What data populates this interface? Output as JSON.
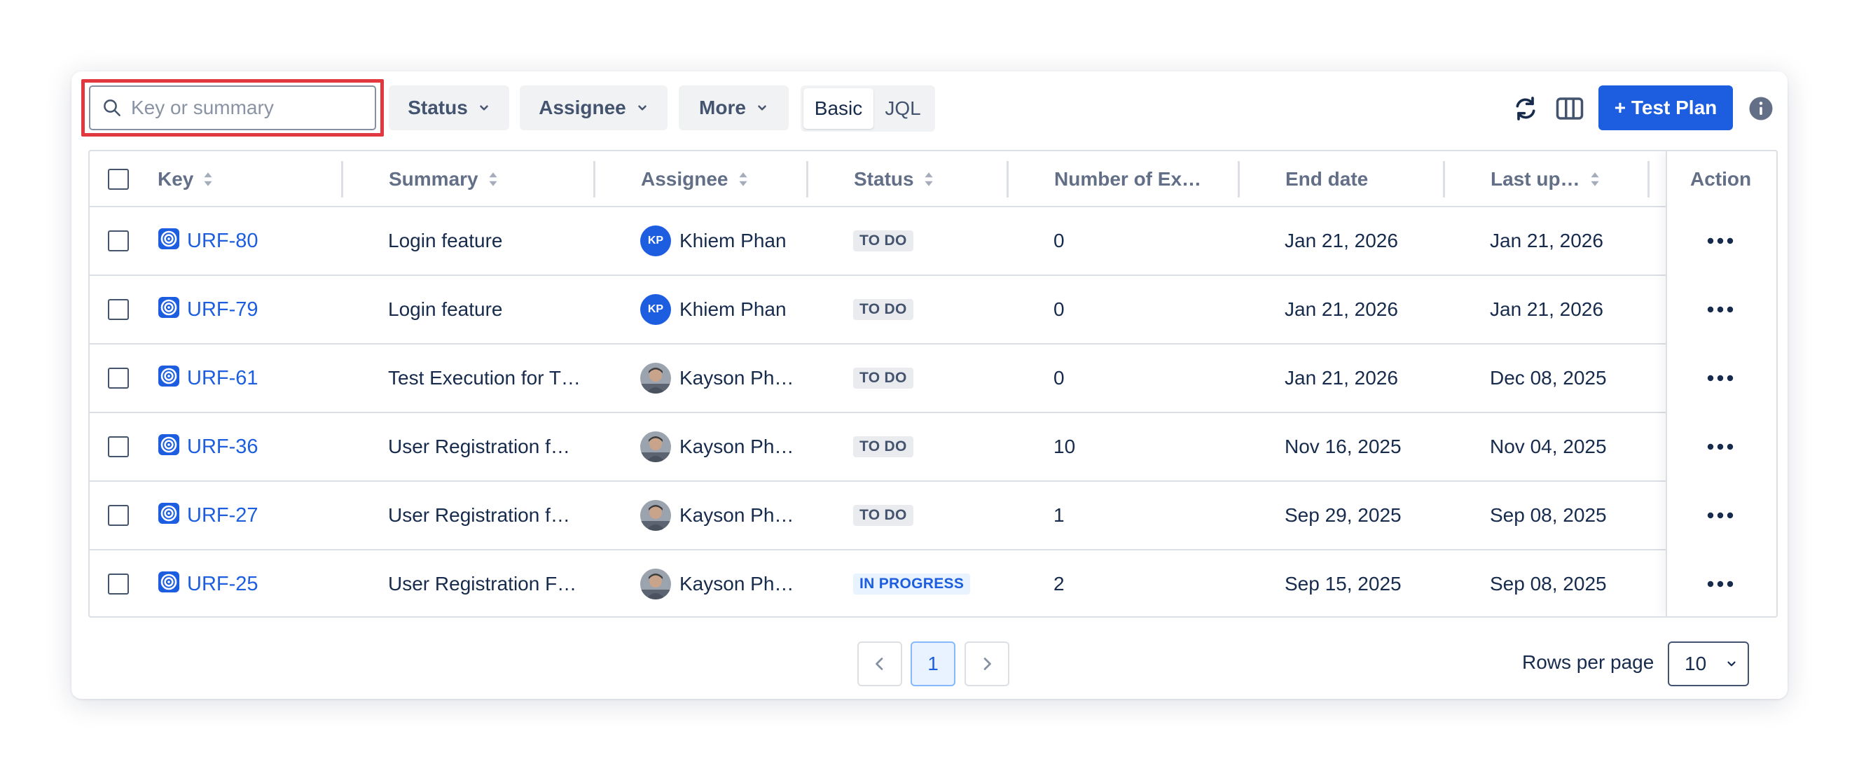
{
  "toolbar": {
    "search_placeholder": "Key or summary",
    "filters": [
      "Status",
      "Assignee",
      "More"
    ],
    "mode_options": [
      "Basic",
      "JQL"
    ],
    "mode_active": "Basic",
    "create_label": "+ Test Plan"
  },
  "table": {
    "columns": [
      "Key",
      "Summary",
      "Assignee",
      "Status",
      "Number of Ex…",
      "End date",
      "Last up…",
      "Action"
    ],
    "rows": [
      {
        "key": "URF-80",
        "summary": "Login feature",
        "assignee": "Khiem Phan",
        "avatar": "KP",
        "status": "TO DO",
        "executions": "0",
        "end_date": "Jan 21, 2026",
        "last_updated": "Jan 21, 2026"
      },
      {
        "key": "URF-79",
        "summary": "Login feature",
        "assignee": "Khiem Phan",
        "avatar": "KP",
        "status": "TO DO",
        "executions": "0",
        "end_date": "Jan 21, 2026",
        "last_updated": "Jan 21, 2026"
      },
      {
        "key": "URF-61",
        "summary": "Test Execution for T…",
        "assignee": "Kayson Ph…",
        "avatar": "",
        "status": "TO DO",
        "executions": "0",
        "end_date": "Jan 21, 2026",
        "last_updated": "Dec 08, 2025"
      },
      {
        "key": "URF-36",
        "summary": "User Registration f…",
        "assignee": "Kayson Ph…",
        "avatar": "",
        "status": "TO DO",
        "executions": "10",
        "end_date": "Nov 16, 2025",
        "last_updated": "Nov 04, 2025"
      },
      {
        "key": "URF-27",
        "summary": "User Registration f…",
        "assignee": "Kayson Ph…",
        "avatar": "",
        "status": "TO DO",
        "executions": "1",
        "end_date": "Sep 29, 2025",
        "last_updated": "Sep 08, 2025"
      },
      {
        "key": "URF-25",
        "summary": "User Registration F…",
        "assignee": "Kayson Ph…",
        "avatar": "",
        "status": "IN PROGRESS",
        "executions": "2",
        "end_date": "Sep 15, 2025",
        "last_updated": "Sep 08, 2025"
      }
    ]
  },
  "pagination": {
    "current_page": "1",
    "rows_per_page_label": "Rows per page",
    "rows_per_page_value": "10"
  },
  "colors": {
    "primary": "#1d5ee0",
    "highlight": "#e0383e",
    "todo_bg": "#e9ebee",
    "in_progress_bg": "#e9f2ff"
  }
}
